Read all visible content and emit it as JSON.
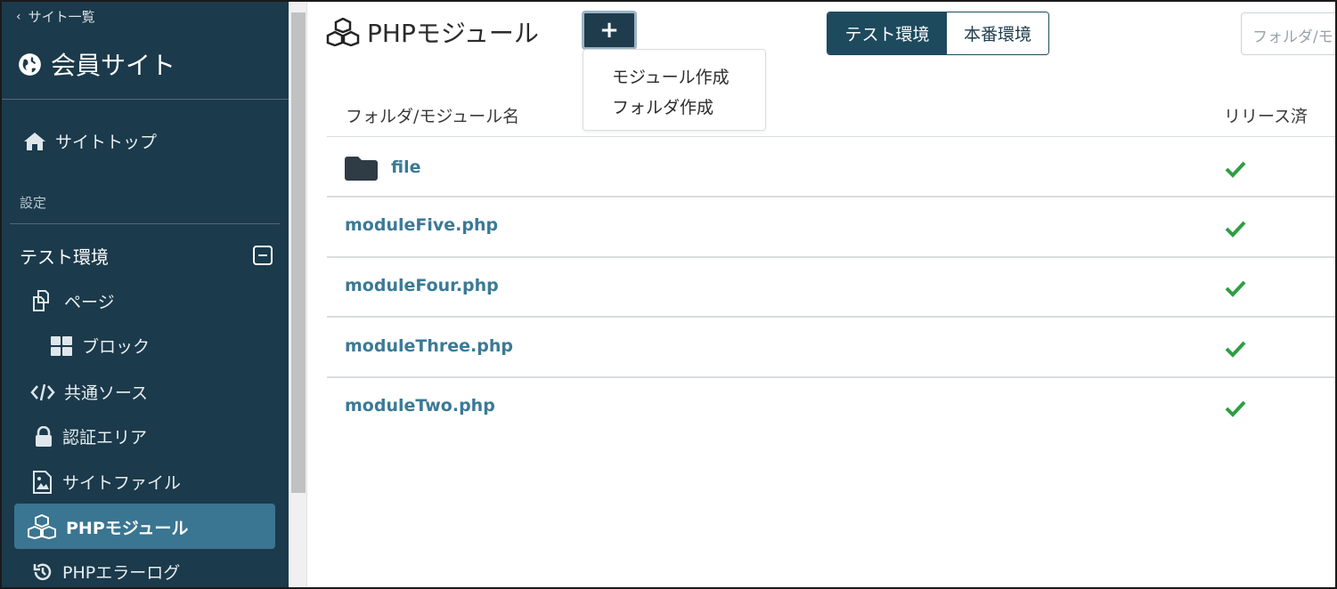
{
  "sidebar": {
    "back_label": "サイト一覧",
    "site_name": "会員サイト",
    "site_top": "サイトトップ",
    "section_label": "設定",
    "env_label": "テスト環境",
    "items": [
      {
        "label": "ページ",
        "icon": "pages-icon"
      },
      {
        "label": "ブロック",
        "icon": "block-grid-icon"
      },
      {
        "label": "共通ソース",
        "icon": "code-icon"
      },
      {
        "label": "認証エリア",
        "icon": "lock-icon"
      },
      {
        "label": "サイトファイル",
        "icon": "image-file-icon"
      },
      {
        "label": "PHPモジュール",
        "icon": "cubes-icon",
        "active": true
      },
      {
        "label": "PHPエラーログ",
        "icon": "history-icon"
      }
    ]
  },
  "header": {
    "title": "PHPモジュール",
    "add_label": "+",
    "dropdown": [
      "モジュール作成",
      "フォルダ作成"
    ],
    "env_tabs": [
      {
        "label": "テスト環境",
        "active": true
      },
      {
        "label": "本番環境",
        "active": false
      }
    ],
    "search_placeholder": "フォルダ/モ"
  },
  "table": {
    "columns": [
      "フォルダ/モジュール名",
      "リリース済"
    ],
    "rows": [
      {
        "name": "file",
        "type": "folder",
        "released": true
      },
      {
        "name": "moduleFive.php",
        "type": "module",
        "released": true
      },
      {
        "name": "moduleFour.php",
        "type": "module",
        "released": true
      },
      {
        "name": "moduleThree.php",
        "type": "module",
        "released": true
      },
      {
        "name": "moduleTwo.php",
        "type": "module",
        "released": true
      }
    ]
  },
  "colors": {
    "sidebar_bg": "#1b3a4b",
    "active_item": "#3a7591",
    "link": "#3a7a96",
    "check": "#2e9e44",
    "button_dark": "#1e3c4c"
  }
}
